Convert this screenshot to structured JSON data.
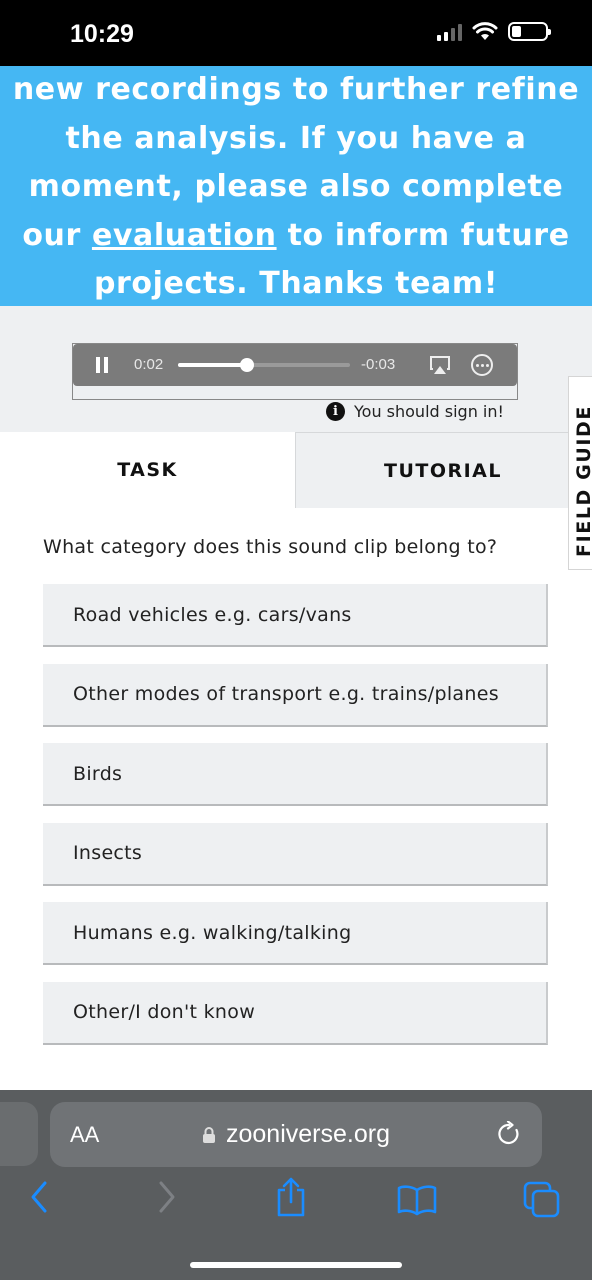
{
  "status_bar": {
    "time": "10:29"
  },
  "banner": {
    "text_before": "new recordings to further refine the analysis. If you have a moment, please also complete our ",
    "link_text": "evaluation",
    "text_after": " to inform future projects. Thanks team!"
  },
  "audio": {
    "elapsed": "0:02",
    "remaining": "-0:03",
    "progress_fraction": 0.4
  },
  "signin": {
    "text": "You should sign in!"
  },
  "tabs": {
    "task": "TASK",
    "tutorial": "TUTORIAL"
  },
  "field_guide": {
    "label": "FIELD GUIDE"
  },
  "question": "What category does this sound clip belong to?",
  "answers": [
    "Road vehicles e.g. cars/vans",
    "Other modes of transport e.g. trains/planes",
    "Birds",
    "Insects",
    "Humans e.g. walking/talking",
    "Other/I don't know"
  ],
  "browser": {
    "aa_label": "AA",
    "url": "zooniverse.org"
  },
  "icons": {
    "pause": "pause-icon",
    "airplay": "airplay-icon",
    "more": "more-icon",
    "info": "info-icon",
    "lock": "lock-icon",
    "reload": "reload-icon",
    "back": "back-icon",
    "forward": "forward-icon",
    "share": "share-icon",
    "bookmarks": "bookmarks-icon",
    "tabs": "tabs-icon"
  },
  "colors": {
    "banner": "#45b7f3",
    "panel": "#eef0f2",
    "toolbar_accent": "#1a8cff"
  }
}
